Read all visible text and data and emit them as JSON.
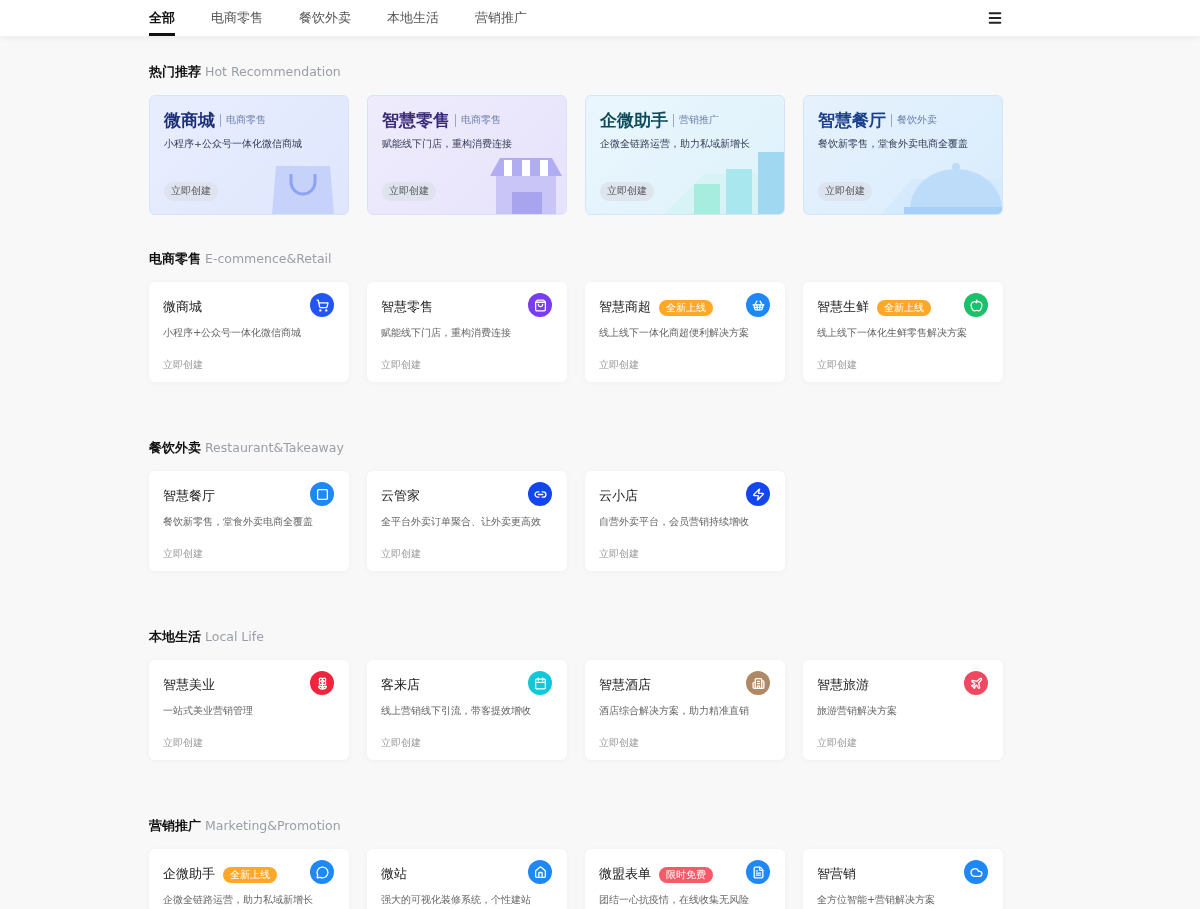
{
  "nav": {
    "tabs": [
      {
        "label": "全部",
        "selected": true
      },
      {
        "label": "电商零售",
        "selected": false
      },
      {
        "label": "餐饮外卖",
        "selected": false
      },
      {
        "label": "本地生活",
        "selected": false
      },
      {
        "label": "营销推广",
        "selected": false
      }
    ]
  },
  "hot": {
    "title": "热门推荐",
    "subtitle": "Hot Recommendation",
    "cards": [
      {
        "title": "微商城",
        "tag": "电商零售",
        "desc": "小程序+公众号一体化微信商城",
        "action": "立即创建"
      },
      {
        "title": "智慧零售",
        "tag": "电商零售",
        "desc": "赋能线下门店，重构消费连接",
        "action": "立即创建"
      },
      {
        "title": "企微助手",
        "tag": "营销推广",
        "desc": "企微全链路运营，助力私域新增长",
        "action": "立即创建"
      },
      {
        "title": "智慧餐厅",
        "tag": "餐饮外卖",
        "desc": "餐饮新零售，堂食外卖电商全覆盖",
        "action": "立即创建"
      }
    ]
  },
  "sections": [
    {
      "title": "电商零售",
      "subtitle": "E-commence&Retail",
      "cards": [
        {
          "title": "微商城",
          "desc": "小程序+公众号一体化微信商城",
          "action": "立即创建",
          "color": "#2355f5"
        },
        {
          "title": "智慧零售",
          "desc": "赋能线下门店，重构消费连接",
          "action": "立即创建",
          "color": "#7a3cf0"
        },
        {
          "title": "智慧商超",
          "badge": {
            "text": "全新上线",
            "color": "#ffa726"
          },
          "desc": "线上线下一体化商超便利解决方案",
          "action": "立即创建",
          "color": "#1e88f5"
        },
        {
          "title": "智慧生鲜",
          "badge": {
            "text": "全新上线",
            "color": "#ffa726"
          },
          "desc": "线上线下一体化生鲜零售解决方案",
          "action": "立即创建",
          "color": "#1bc06a"
        }
      ]
    },
    {
      "title": "餐饮外卖",
      "subtitle": "Restaurant&Takeaway",
      "cards": [
        {
          "title": "智慧餐厅",
          "desc": "餐饮新零售，堂食外卖电商全覆盖",
          "action": "立即创建",
          "color": "#1e88f5"
        },
        {
          "title": "云管家",
          "desc": "全平台外卖订单聚合、让外卖更高效",
          "action": "立即创建",
          "color": "#1446f0"
        },
        {
          "title": "云小店",
          "desc": "自营外卖平台，会员营销持续增收",
          "action": "立即创建",
          "color": "#1446f0"
        }
      ]
    },
    {
      "title": "本地生活",
      "subtitle": "Local Life",
      "cards": [
        {
          "title": "智慧美业",
          "desc": "一站式美业营销管理",
          "action": "立即创建",
          "color": "#f0243c"
        },
        {
          "title": "客来店",
          "desc": "线上营销线下引流，带客提效增收",
          "action": "立即创建",
          "color": "#12c8d8"
        },
        {
          "title": "智慧酒店",
          "desc": "酒店综合解决方案，助力精准直销",
          "action": "立即创建",
          "color": "#b08864"
        },
        {
          "title": "智慧旅游",
          "desc": "旅游营销解决方案",
          "action": "立即创建",
          "color": "#f04860"
        }
      ]
    },
    {
      "title": "营销推广",
      "subtitle": "Marketing&Promotion",
      "cards": [
        {
          "title": "企微助手",
          "badge": {
            "text": "全新上线",
            "color": "#ffa726"
          },
          "desc": "企微全链路运营，助力私域新增长",
          "color": "#1e88f5"
        },
        {
          "title": "微站",
          "desc": "强大的可视化装修系统，个性建站",
          "color": "#1e88f5"
        },
        {
          "title": "微盟表单",
          "badge": {
            "text": "限时免费",
            "color": "#f55a6a"
          },
          "desc": "团结一心抗疫情，在线收集无风险",
          "color": "#1e88f5"
        },
        {
          "title": "智营销",
          "desc": "全方位智能+营销解决方案",
          "color": "#1e88f5"
        }
      ]
    }
  ]
}
